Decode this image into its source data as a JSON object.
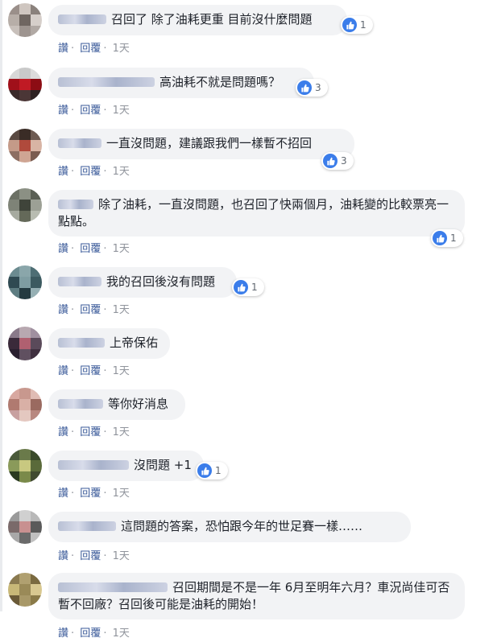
{
  "actions": {
    "like": "讚",
    "reply": "回覆",
    "time": "1天",
    "dot": "·"
  },
  "colors": {
    "link": "#385898",
    "bubble": "#f2f3f5",
    "like_badge": "#3b7dea"
  },
  "comments": [
    {
      "text": "召回了 除了油耗更重 目前沒什麼問題",
      "reactions": "1"
    },
    {
      "text": "高油耗不就是問題嗎？",
      "reactions": "3"
    },
    {
      "text": "一直沒問題，建議跟我們一樣暫不招回",
      "reactions": "3"
    },
    {
      "text": "除了油耗，一直沒問題，也召回了快兩個月，油耗變的比較票亮一點點。",
      "reactions": "1"
    },
    {
      "text": "我的召回後沒有問題",
      "reactions": "1"
    },
    {
      "text": "上帝保佑",
      "reactions": ""
    },
    {
      "text": "等你好消息",
      "reactions": ""
    },
    {
      "text": "沒問題 +1",
      "reactions": "1"
    },
    {
      "text": "這問題的答案，恐怕跟今年的世足賽一樣……",
      "reactions": ""
    },
    {
      "text": "召回期間是不是一年 6月至明年六月？車況尚佳可否暫不回廠？召回後可能是油耗的開始！",
      "reactions": ""
    }
  ]
}
